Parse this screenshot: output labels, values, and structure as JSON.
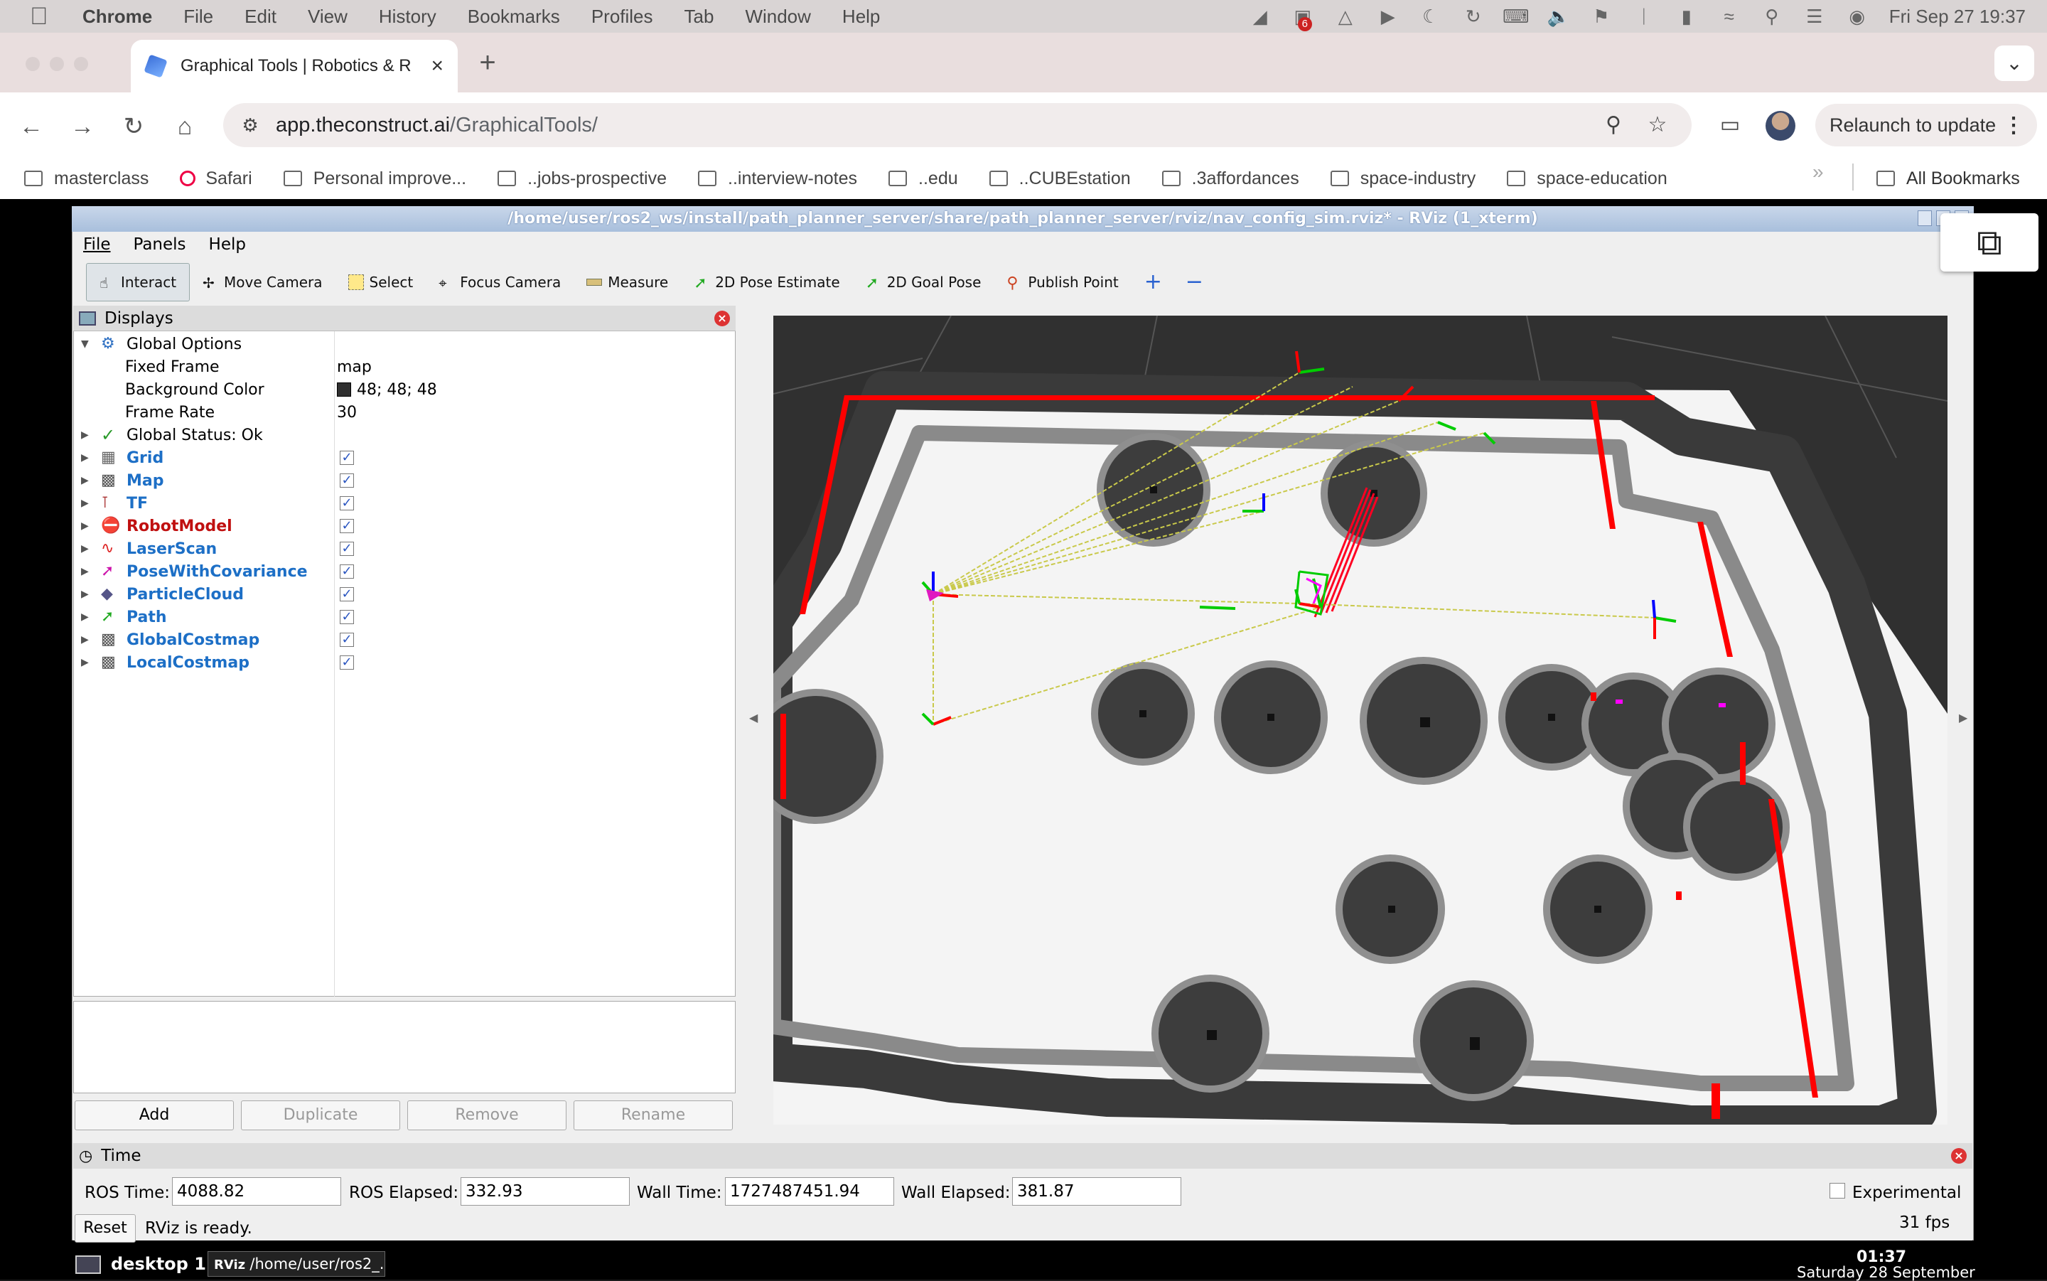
{
  "macos": {
    "menu": [
      "Chrome",
      "File",
      "Edit",
      "View",
      "History",
      "Bookmarks",
      "Profiles",
      "Tab",
      "Window",
      "Help"
    ],
    "notification_badge": "6",
    "datetime": "Fri Sep 27  19:37"
  },
  "browser": {
    "tab_title": "Graphical Tools | Robotics & R",
    "url_host": "app.theconstruct.ai",
    "url_path": "/GraphicalTools/",
    "relaunch_label": "Relaunch to update",
    "bookmarks": [
      {
        "label": "masterclass",
        "icon": "folder-icon"
      },
      {
        "label": "Safari",
        "icon": "safari-icon"
      },
      {
        "label": "Personal improve...",
        "icon": "folder-icon"
      },
      {
        "label": "..jobs-prospective",
        "icon": "folder-icon"
      },
      {
        "label": "..interview-notes",
        "icon": "folder-icon"
      },
      {
        "label": "..edu",
        "icon": "folder-icon"
      },
      {
        "label": "..CUBEstation",
        "icon": "folder-icon"
      },
      {
        "label": ".3affordances",
        "icon": "folder-icon"
      },
      {
        "label": "space-industry",
        "icon": "folder-icon"
      },
      {
        "label": "space-education",
        "icon": "folder-icon"
      }
    ],
    "all_bookmarks": "All Bookmarks"
  },
  "rviz": {
    "title": "/home/user/ros2_ws/install/path_planner_server/share/path_planner_server/rviz/nav_config_sim.rviz* - RViz (1_xterm)",
    "menu": [
      "File",
      "Panels",
      "Help"
    ],
    "tools": [
      "Interact",
      "Move Camera",
      "Select",
      "Focus Camera",
      "Measure",
      "2D Pose Estimate",
      "2D Goal Pose",
      "Publish Point"
    ],
    "displays_title": "Displays",
    "global_options": {
      "label": "Global Options",
      "fixed_frame_label": "Fixed Frame",
      "fixed_frame": "map",
      "bg_label": "Background Color",
      "bg_value": "48; 48; 48",
      "rate_label": "Frame Rate",
      "rate_value": "30"
    },
    "global_status": "Global Status: Ok",
    "displays": [
      {
        "name": "Grid",
        "color": "blue"
      },
      {
        "name": "Map",
        "color": "blue"
      },
      {
        "name": "TF",
        "color": "blue"
      },
      {
        "name": "RobotModel",
        "color": "red"
      },
      {
        "name": "LaserScan",
        "color": "blue"
      },
      {
        "name": "PoseWithCovariance",
        "color": "blue"
      },
      {
        "name": "ParticleCloud",
        "color": "blue"
      },
      {
        "name": "Path",
        "color": "blue"
      },
      {
        "name": "GlobalCostmap",
        "color": "blue"
      },
      {
        "name": "LocalCostmap",
        "color": "blue"
      }
    ],
    "buttons": {
      "add": "Add",
      "duplicate": "Duplicate",
      "remove": "Remove",
      "rename": "Rename"
    },
    "time": {
      "title": "Time",
      "ros_time_label": "ROS Time:",
      "ros_time": "4088.82",
      "ros_elapsed_label": "ROS Elapsed:",
      "ros_elapsed": "332.93",
      "wall_time_label": "Wall Time:",
      "wall_time": "1727487451.94",
      "wall_elapsed_label": "Wall Elapsed:",
      "wall_elapsed": "381.87",
      "experimental": "Experimental",
      "reset": "Reset",
      "status": "RViz is ready.",
      "fps": "31 fps"
    }
  },
  "desktop": {
    "workspace": "desktop 1",
    "task": "/home/user/ros2_...",
    "clock": "01:37",
    "date": "Saturday 28 September"
  }
}
